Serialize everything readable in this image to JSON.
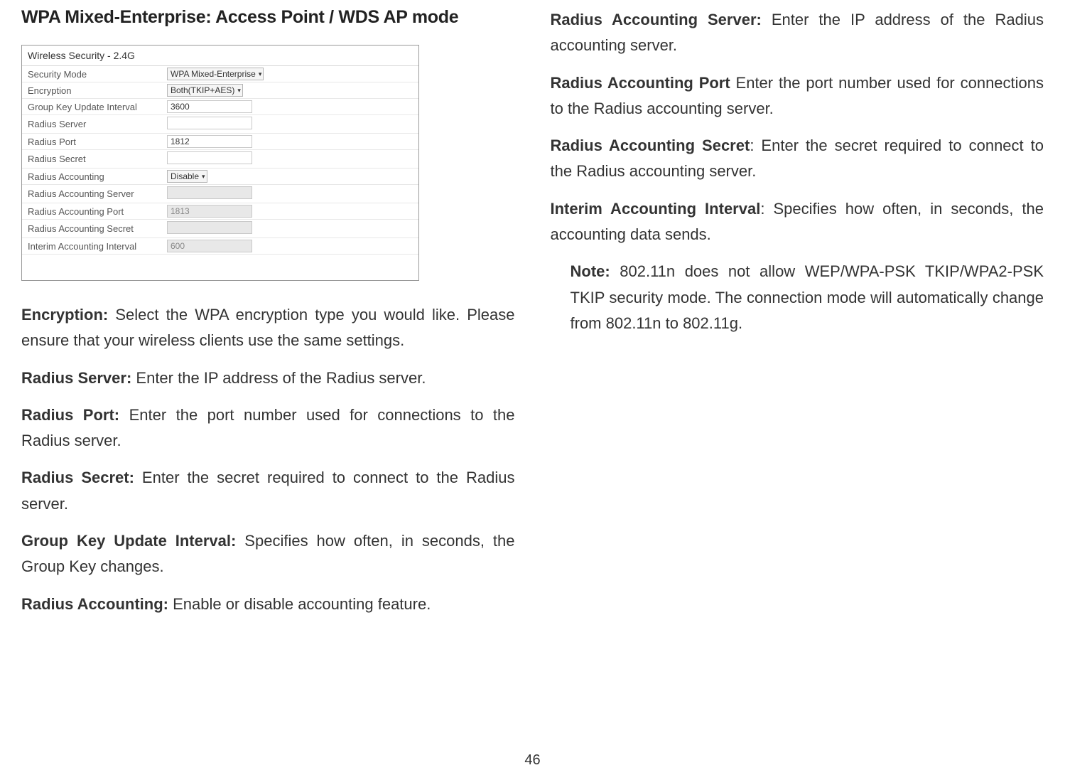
{
  "heading": "WPA Mixed-Enterprise: Access Point / WDS AP mode",
  "screenshot": {
    "title": "Wireless Security - 2.4G",
    "rows": [
      {
        "label": "Security Mode",
        "type": "select",
        "value": "WPA Mixed-Enterprise"
      },
      {
        "label": "Encryption",
        "type": "select",
        "value": "Both(TKIP+AES)"
      },
      {
        "label": "Group Key Update Interval",
        "type": "input",
        "value": "3600",
        "disabled": false
      },
      {
        "label": "Radius Server",
        "type": "input",
        "value": "",
        "disabled": false
      },
      {
        "label": "Radius Port",
        "type": "input",
        "value": "1812",
        "disabled": false
      },
      {
        "label": "Radius Secret",
        "type": "input",
        "value": "",
        "disabled": false
      },
      {
        "label": "Radius Accounting",
        "type": "select",
        "value": "Disable"
      },
      {
        "label": "Radius Accounting Server",
        "type": "input",
        "value": "",
        "disabled": true
      },
      {
        "label": "Radius Accounting Port",
        "type": "input",
        "value": "1813",
        "disabled": true
      },
      {
        "label": "Radius Accounting Secret",
        "type": "input",
        "value": "",
        "disabled": true
      },
      {
        "label": "Interim Accounting Interval",
        "type": "input",
        "value": "600",
        "disabled": true
      }
    ]
  },
  "left_paras": [
    {
      "bold": "Encryption:",
      "text": " Select the WPA encryption type you would like. Please ensure that your wireless clients use the same settings."
    },
    {
      "bold": "Radius Server:",
      "text": " Enter the IP address of the Radius server."
    },
    {
      "bold": "Radius Port:",
      "text": " Enter the port number used for connections to the Radius server."
    },
    {
      "bold": "Radius Secret:",
      "text": " Enter the secret required to connect to the Radius server."
    },
    {
      "bold": "Group Key Update Interval:",
      "text": " Specifies how often, in seconds, the Group Key changes."
    },
    {
      "bold": "Radius Accounting:",
      "text": " Enable or disable accounting feature."
    }
  ],
  "right_paras": [
    {
      "bold": "Radius Accounting Server:",
      "text": " Enter the IP address of the Radius accounting server."
    },
    {
      "bold": "Radius Accounting Port",
      "text": " Enter the port number used for connections to the Radius accounting server."
    },
    {
      "bold": "Radius Accounting Secret",
      "text": ": Enter the secret required to connect to the Radius accounting server."
    },
    {
      "bold": "Interim Accounting Interval",
      "text": ": Specifies how often, in seconds, the accounting data sends."
    }
  ],
  "note": {
    "bold": "Note:",
    "text": " 802.11n does not allow WEP/WPA-PSK TKIP/WPA2-PSK TKIP security mode. The connection mode will automatically change from 802.11n to 802.11g."
  },
  "page_number": "46"
}
